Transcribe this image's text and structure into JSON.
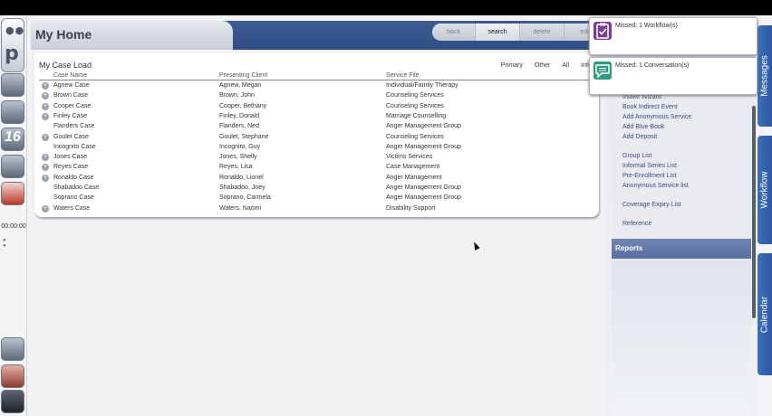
{
  "dock": {
    "logo_letter": "p",
    "badge_number": "16",
    "timer": "00:00:00"
  },
  "header": {
    "title": "My Home",
    "nav": [
      {
        "label": "back"
      },
      {
        "label": "search"
      },
      {
        "label": "delete"
      },
      {
        "label": "edi"
      }
    ]
  },
  "caseload": {
    "title": "My Case Load",
    "filters": [
      "Primary",
      "Other",
      "All",
      "Inform"
    ],
    "columns": [
      "Case Name",
      "Presenting Client",
      "Service File"
    ],
    "rows": [
      {
        "case": "Agnew Case",
        "client": "Agnew, Megan",
        "service": "Individual/Family Therapy",
        "expandable": true
      },
      {
        "case": "Brown Case",
        "client": "Brown, John",
        "service": "Counseling Services",
        "expandable": true
      },
      {
        "case": "Cooper Case",
        "client": "Cooper, Bethany",
        "service": "Counseling Services",
        "expandable": true
      },
      {
        "case": "Finley Case",
        "client": "Finley, Donald",
        "service": "Marriage Counselling",
        "expandable": true
      },
      {
        "case": "Flanders Case",
        "client": "Flanders, Ned",
        "service": "Anger Management Group",
        "expandable": false
      },
      {
        "case": "Goulet Case",
        "client": "Goulet, Stephane",
        "service": "Counseling Services",
        "expandable": true
      },
      {
        "case": "Incognito Case",
        "client": "Incognito, Guy",
        "service": "Anger Management Group",
        "expandable": false
      },
      {
        "case": "Jones Case",
        "client": "Jones, Shelly",
        "service": "Victims Services",
        "expandable": true
      },
      {
        "case": "Reyes Case",
        "client": "Reyes, Lisa",
        "service": "Case Management",
        "expandable": true
      },
      {
        "case": "Ronaldo Case",
        "client": "Ronaldo, Lionel",
        "service": "Anger Management",
        "expandable": true
      },
      {
        "case": "Shabadoo Case",
        "client": "Shabadoo, Joey",
        "service": "Anger Management Group",
        "expandable": false
      },
      {
        "case": "Soprano Case",
        "client": "Soprano, Carmela",
        "service": "Anger Management Group",
        "expandable": false
      },
      {
        "case": "Waters Case",
        "client": "Waters, Naomi",
        "service": "Disability Support",
        "expandable": true
      }
    ]
  },
  "links": {
    "group1": [
      "Intake Wizard",
      "Book Indirect Event",
      "Add Anonymous Service",
      "Add Blue Book",
      "Add Deposit"
    ],
    "group2": [
      "Group List",
      "Informal Series List",
      "Pre-Enrollment List",
      "Anonymous Service list"
    ],
    "group3": [
      "Coverage Expiry List"
    ],
    "group4": [
      "Reference"
    ],
    "reports_label": "Reports"
  },
  "side_tabs": {
    "messages": "Messages",
    "workflow": "Workflow",
    "calendar": "Calendar"
  },
  "notifications": [
    {
      "text": "Missed: 1 Workflow(s)",
      "icon": "clipboard-check-icon",
      "color": "#7b3f8f"
    },
    {
      "text": "Missed: 1 Conversation(s)",
      "icon": "chat-bubble-icon",
      "color": "#2e9a82"
    }
  ]
}
